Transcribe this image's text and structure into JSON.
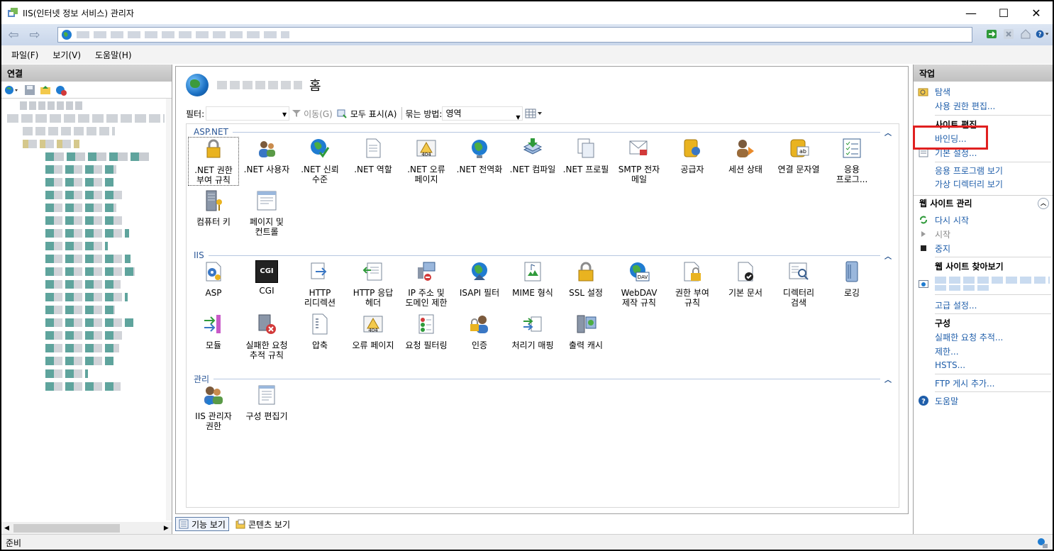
{
  "window": {
    "title": "IIS(인터넷 정보 서비스) 관리자",
    "controls": {
      "minimize": "—",
      "maximize": "☐",
      "close": "✕"
    }
  },
  "menu": [
    "파일(F)",
    "보기(V)",
    "도움말(H)"
  ],
  "connections": {
    "header": "연결"
  },
  "home": {
    "label": "홈"
  },
  "filterbar": {
    "filter_label": "필터:",
    "go_label": "이동(G)",
    "show_all_label": "모두 표시(A)",
    "group_by_label": "묶는 방법:",
    "group_by_value": "영역"
  },
  "sections": {
    "aspnet": {
      "title": "ASP.NET",
      "items": [
        ".NET 권한\n부여 규칙",
        ".NET 사용자",
        ".NET 신뢰\n수준",
        ".NET 역할",
        ".NET 오류\n페이지",
        ".NET 전역화",
        ".NET 컴파일",
        ".NET 프로필",
        "SMTP 전자\n메일",
        "공급자",
        "세션 상태",
        "연결 문자열",
        "응용\n프로그...",
        "컴퓨터 키",
        "페이지 및\n컨트롤"
      ]
    },
    "iis": {
      "title": "IIS",
      "items": [
        "ASP",
        "CGI",
        "HTTP\n리디렉션",
        "HTTP 응답\n헤더",
        "IP 주소 및\n도메인 제한",
        "ISAPI 필터",
        "MIME 형식",
        "SSL 설정",
        "WebDAV\n제작 규칙",
        "권한 부여\n규칙",
        "기본 문서",
        "디렉터리\n검색",
        "로깅",
        "모듈",
        "실패한 요청\n추적 규칙",
        "압축",
        "오류 페이지",
        "요청 필터링",
        "인증",
        "처리기 매핑",
        "출력 캐시"
      ]
    },
    "management": {
      "title": "관리",
      "items": [
        "IIS 관리자\n권한",
        "구성 편집기"
      ]
    }
  },
  "view_tabs": {
    "features": "기능 보기",
    "content": "콘텐츠 보기"
  },
  "actions": {
    "header": "작업",
    "explore": "탐색",
    "edit_permissions": "사용 권한 편집...",
    "edit_site": "사이트 편집",
    "bindings": "바인딩...",
    "basic_settings": "기본 설정...",
    "view_apps": "응용 프로그램 보기",
    "view_vdirs": "가상 디렉터리 보기",
    "manage_site": "웹 사이트 관리",
    "restart": "다시 시작",
    "start": "시작",
    "stop": "중지",
    "browse_site": "웹 사이트 찾아보기",
    "advanced_settings": "고급 설정...",
    "configure": "구성",
    "failed_request_tracing": "실패한 요청 추적...",
    "limits": "제한...",
    "hsts": "HSTS...",
    "add_ftp": "FTP 게시 추가...",
    "help": "도움말"
  },
  "status": {
    "text": "준비"
  },
  "colors": {
    "link": "#1f5eaa",
    "section": "#2b5797",
    "highlight": "#e02020"
  }
}
